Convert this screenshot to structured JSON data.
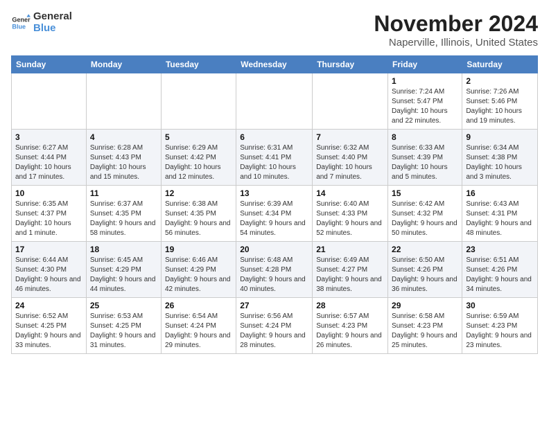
{
  "header": {
    "logo_general": "General",
    "logo_blue": "Blue",
    "month": "November 2024",
    "location": "Naperville, Illinois, United States"
  },
  "weekdays": [
    "Sunday",
    "Monday",
    "Tuesday",
    "Wednesday",
    "Thursday",
    "Friday",
    "Saturday"
  ],
  "weeks": [
    [
      {
        "day": "",
        "info": ""
      },
      {
        "day": "",
        "info": ""
      },
      {
        "day": "",
        "info": ""
      },
      {
        "day": "",
        "info": ""
      },
      {
        "day": "",
        "info": ""
      },
      {
        "day": "1",
        "info": "Sunrise: 7:24 AM\nSunset: 5:47 PM\nDaylight: 10 hours and 22 minutes."
      },
      {
        "day": "2",
        "info": "Sunrise: 7:26 AM\nSunset: 5:46 PM\nDaylight: 10 hours and 19 minutes."
      }
    ],
    [
      {
        "day": "3",
        "info": "Sunrise: 6:27 AM\nSunset: 4:44 PM\nDaylight: 10 hours and 17 minutes."
      },
      {
        "day": "4",
        "info": "Sunrise: 6:28 AM\nSunset: 4:43 PM\nDaylight: 10 hours and 15 minutes."
      },
      {
        "day": "5",
        "info": "Sunrise: 6:29 AM\nSunset: 4:42 PM\nDaylight: 10 hours and 12 minutes."
      },
      {
        "day": "6",
        "info": "Sunrise: 6:31 AM\nSunset: 4:41 PM\nDaylight: 10 hours and 10 minutes."
      },
      {
        "day": "7",
        "info": "Sunrise: 6:32 AM\nSunset: 4:40 PM\nDaylight: 10 hours and 7 minutes."
      },
      {
        "day": "8",
        "info": "Sunrise: 6:33 AM\nSunset: 4:39 PM\nDaylight: 10 hours and 5 minutes."
      },
      {
        "day": "9",
        "info": "Sunrise: 6:34 AM\nSunset: 4:38 PM\nDaylight: 10 hours and 3 minutes."
      }
    ],
    [
      {
        "day": "10",
        "info": "Sunrise: 6:35 AM\nSunset: 4:37 PM\nDaylight: 10 hours and 1 minute."
      },
      {
        "day": "11",
        "info": "Sunrise: 6:37 AM\nSunset: 4:35 PM\nDaylight: 9 hours and 58 minutes."
      },
      {
        "day": "12",
        "info": "Sunrise: 6:38 AM\nSunset: 4:35 PM\nDaylight: 9 hours and 56 minutes."
      },
      {
        "day": "13",
        "info": "Sunrise: 6:39 AM\nSunset: 4:34 PM\nDaylight: 9 hours and 54 minutes."
      },
      {
        "day": "14",
        "info": "Sunrise: 6:40 AM\nSunset: 4:33 PM\nDaylight: 9 hours and 52 minutes."
      },
      {
        "day": "15",
        "info": "Sunrise: 6:42 AM\nSunset: 4:32 PM\nDaylight: 9 hours and 50 minutes."
      },
      {
        "day": "16",
        "info": "Sunrise: 6:43 AM\nSunset: 4:31 PM\nDaylight: 9 hours and 48 minutes."
      }
    ],
    [
      {
        "day": "17",
        "info": "Sunrise: 6:44 AM\nSunset: 4:30 PM\nDaylight: 9 hours and 46 minutes."
      },
      {
        "day": "18",
        "info": "Sunrise: 6:45 AM\nSunset: 4:29 PM\nDaylight: 9 hours and 44 minutes."
      },
      {
        "day": "19",
        "info": "Sunrise: 6:46 AM\nSunset: 4:29 PM\nDaylight: 9 hours and 42 minutes."
      },
      {
        "day": "20",
        "info": "Sunrise: 6:48 AM\nSunset: 4:28 PM\nDaylight: 9 hours and 40 minutes."
      },
      {
        "day": "21",
        "info": "Sunrise: 6:49 AM\nSunset: 4:27 PM\nDaylight: 9 hours and 38 minutes."
      },
      {
        "day": "22",
        "info": "Sunrise: 6:50 AM\nSunset: 4:26 PM\nDaylight: 9 hours and 36 minutes."
      },
      {
        "day": "23",
        "info": "Sunrise: 6:51 AM\nSunset: 4:26 PM\nDaylight: 9 hours and 34 minutes."
      }
    ],
    [
      {
        "day": "24",
        "info": "Sunrise: 6:52 AM\nSunset: 4:25 PM\nDaylight: 9 hours and 33 minutes."
      },
      {
        "day": "25",
        "info": "Sunrise: 6:53 AM\nSunset: 4:25 PM\nDaylight: 9 hours and 31 minutes."
      },
      {
        "day": "26",
        "info": "Sunrise: 6:54 AM\nSunset: 4:24 PM\nDaylight: 9 hours and 29 minutes."
      },
      {
        "day": "27",
        "info": "Sunrise: 6:56 AM\nSunset: 4:24 PM\nDaylight: 9 hours and 28 minutes."
      },
      {
        "day": "28",
        "info": "Sunrise: 6:57 AM\nSunset: 4:23 PM\nDaylight: 9 hours and 26 minutes."
      },
      {
        "day": "29",
        "info": "Sunrise: 6:58 AM\nSunset: 4:23 PM\nDaylight: 9 hours and 25 minutes."
      },
      {
        "day": "30",
        "info": "Sunrise: 6:59 AM\nSunset: 4:23 PM\nDaylight: 9 hours and 23 minutes."
      }
    ]
  ]
}
